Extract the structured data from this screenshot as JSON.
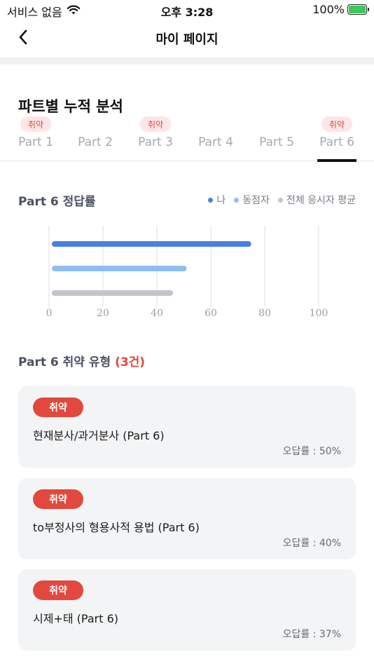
{
  "status_bar": {
    "carrier": "서비스 없음",
    "time": "오후 3:28",
    "battery": "100%",
    "battery_level": 1.0
  },
  "nav": {
    "title": "마이 페이지"
  },
  "section": {
    "title": "파트별 누적 분석"
  },
  "tabs": [
    {
      "label": "Part 1",
      "badge": "취약",
      "weak": true,
      "active": false
    },
    {
      "label": "Part 2",
      "badge": "",
      "weak": false,
      "active": false
    },
    {
      "label": "Part 3",
      "badge": "취약",
      "weak": true,
      "active": false
    },
    {
      "label": "Part 4",
      "badge": "",
      "weak": false,
      "active": false
    },
    {
      "label": "Part 5",
      "badge": "",
      "weak": false,
      "active": false
    },
    {
      "label": "Part 6",
      "badge": "취약",
      "weak": true,
      "active": true
    }
  ],
  "chart_section": {
    "title": "Part 6 정답률",
    "legend": [
      {
        "label": "나",
        "color": "#4a7fe8"
      },
      {
        "label": "동점자",
        "color": "#8dbdf5"
      },
      {
        "label": "전체 응시자 평균",
        "color": "#c2c5cb"
      }
    ]
  },
  "chart_data": {
    "type": "bar",
    "orientation": "horizontal",
    "series": [
      {
        "name": "나",
        "values": [
          75
        ],
        "color": "#4a7fe8"
      },
      {
        "name": "동점자",
        "values": [
          51
        ],
        "color": "#8dbdf5"
      },
      {
        "name": "전체 응시자 평균",
        "values": [
          46
        ],
        "color": "#c2c5cb"
      }
    ],
    "xlim": [
      0,
      100
    ],
    "xticks": [
      "0",
      "20",
      "40",
      "60",
      "80",
      "100"
    ],
    "grid": true,
    "legend_position": "top-right"
  },
  "weak_section": {
    "title_prefix": "Part 6 취약 유형",
    "count": "(3건)"
  },
  "weak_items": [
    {
      "badge": "취약",
      "title": "현재분사/과거분사 (Part 6)",
      "rate": "오답률 : 50%"
    },
    {
      "badge": "취약",
      "title": "to부정사의 형용사적 용법 (Part 6)",
      "rate": "오답률 : 40%"
    },
    {
      "badge": "취약",
      "title": "시제+태 (Part 6)",
      "rate": "오답률 : 37%"
    }
  ],
  "colors": {
    "accent": "#e2483d",
    "card_bg": "#f3f4f5"
  }
}
